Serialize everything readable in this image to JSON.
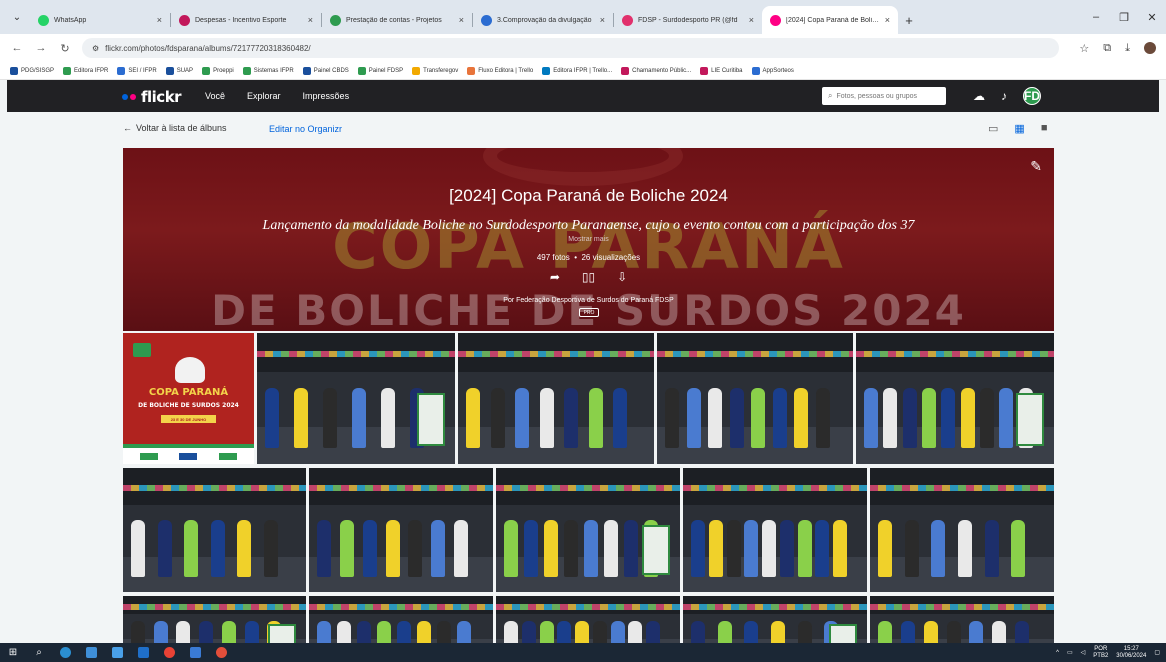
{
  "browser": {
    "tabs": [
      {
        "title": "WhatsApp",
        "favicon_color": "#25d366",
        "width": 140,
        "active": false
      },
      {
        "title": "Despesas - Incentivo Esporte",
        "favicon_color": "#c2185b",
        "width": 150,
        "active": false
      },
      {
        "title": "Prestação de contas - Projetos",
        "favicon_color": "#2e9b4f",
        "width": 150,
        "active": false
      },
      {
        "title": "3.Comprovação da divulgação",
        "favicon_color": "#2b6cd1",
        "width": 140,
        "active": false
      },
      {
        "title": "FDSP - Surdodesporto PR (@fd",
        "favicon_color": "#e1306c",
        "width": 148,
        "active": false
      },
      {
        "title": "[2024] Copa Paraná de Boliche",
        "favicon_color": "#ff0084",
        "width": 136,
        "active": true
      }
    ],
    "url": "flickr.com/photos/fdsparana/albums/72177720318360482/",
    "bookmarks": [
      {
        "label": "PDG/SISGP",
        "color": "#1a4f9c"
      },
      {
        "label": "Editora IFPR",
        "color": "#2e9b4f"
      },
      {
        "label": "SEI / IFPR",
        "color": "#2b6cd1"
      },
      {
        "label": "SUAP",
        "color": "#1a4f9c"
      },
      {
        "label": "Proeppi",
        "color": "#2e9b4f"
      },
      {
        "label": "Sistemas IFPR",
        "color": "#2e9b4f"
      },
      {
        "label": "Painel CBDS",
        "color": "#1a4f9c"
      },
      {
        "label": "Painel FDSP",
        "color": "#2e9b4f"
      },
      {
        "label": "Transferegov",
        "color": "#f2a900"
      },
      {
        "label": "Fluxo Editora | Trello",
        "color": "#e8743b"
      },
      {
        "label": "Editora IFPR | Trello...",
        "color": "#0079bf"
      },
      {
        "label": "Chamamento Públic...",
        "color": "#c2185b"
      },
      {
        "label": "LIE Curitiba",
        "color": "#c2185b"
      },
      {
        "label": "AppSorteos",
        "color": "#2b6cd1"
      }
    ]
  },
  "flickr": {
    "logo": "flickr",
    "nav": [
      "Você",
      "Explorar",
      "Impressões"
    ],
    "search_placeholder": "Fotos, pessoas ou grupos",
    "avatar_initials": "FD"
  },
  "album": {
    "back_label": "Voltar à lista de álbuns",
    "edit_label": "Editar no Organizr",
    "title": "[2024] Copa Paraná de Boliche 2024",
    "description": "Lançamento da modalidade Boliche no Surdodesporto Paranaense, cujo o evento contou com a participação dos 37",
    "more_label": "Mostrar mais",
    "photos_count": "497 fotos",
    "views_count": "26 visualizações",
    "owner": "Por Federação Desportiva de Surdos do Paraná FDSP",
    "pro_badge": "PRO",
    "bg_line1": "COPA PARANÁ",
    "bg_line2": "DE BOLICHE DE SURDOS 2024"
  },
  "poster": {
    "line1": "COPA PARANÁ",
    "line2": "DE BOLICHE DE SURDOS 2024",
    "date": "23 E 30 DE JUNHO"
  },
  "taskbar": {
    "lang": "POR",
    "lang2": "PTB2",
    "time": "15:27",
    "date": "30/06/2024"
  }
}
